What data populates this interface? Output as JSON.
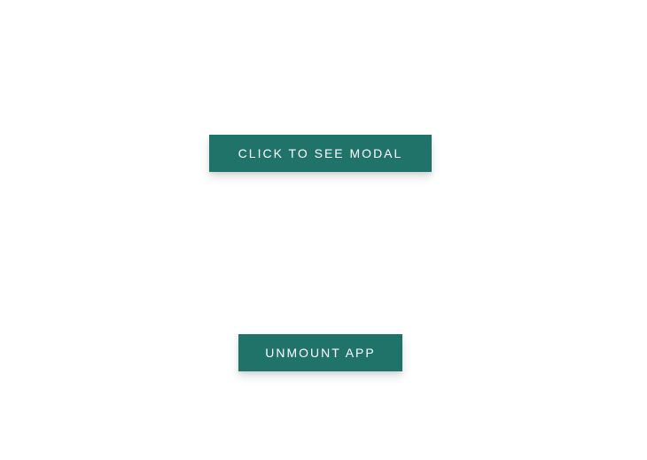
{
  "buttons": {
    "modal_label": "CLICK TO SEE MODAL",
    "unmount_label": "UNMOUNT APP"
  },
  "colors": {
    "background": "#ffffff",
    "button_bg": "#1f7368",
    "button_text": "#ffffff"
  }
}
